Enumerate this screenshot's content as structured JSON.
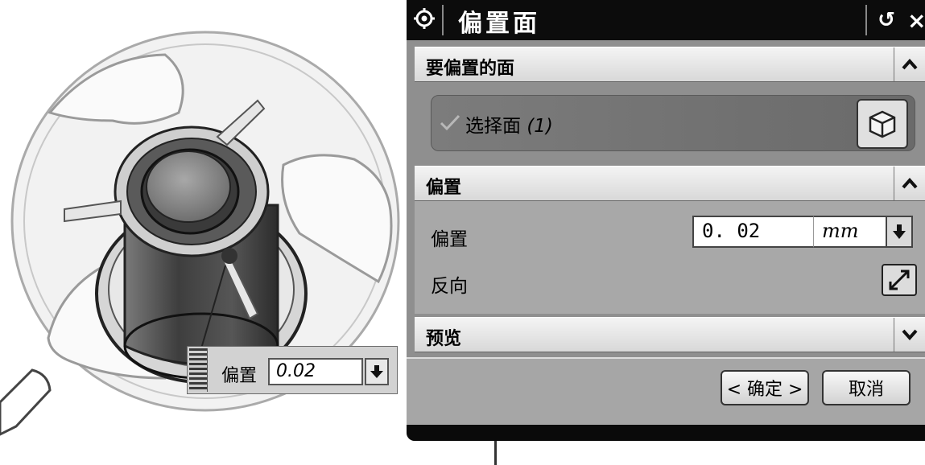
{
  "floating_input": {
    "label": "偏置",
    "value": "0.02"
  },
  "dialog": {
    "title": "偏置面",
    "reset_glyph": "↺",
    "close_glyph": "×",
    "sections": {
      "faces": {
        "header": "要偏置的面",
        "select_label": "选择面",
        "select_count": "(1)"
      },
      "offset": {
        "header": "偏置",
        "offset_label": "偏置",
        "offset_value": "0. 02",
        "unit": "mm",
        "reverse_label": "反向"
      },
      "preview": {
        "header": "预览"
      }
    },
    "buttons": {
      "ok": "< 确定 >",
      "cancel": "取消"
    }
  },
  "icons": [
    "gear-icon",
    "reset-icon",
    "close-icon",
    "collapse-up-icon",
    "expand-down-icon",
    "checkmark-icon",
    "cube-select-icon",
    "dropdown-arrow-icon",
    "reverse-direction-icon",
    "grip-icon"
  ],
  "colors": {
    "titlebar": "#0c0c0c",
    "dialog_bg": "#8f8f8f",
    "selection_row": "#747474",
    "section_header": "#e6e6e6"
  }
}
